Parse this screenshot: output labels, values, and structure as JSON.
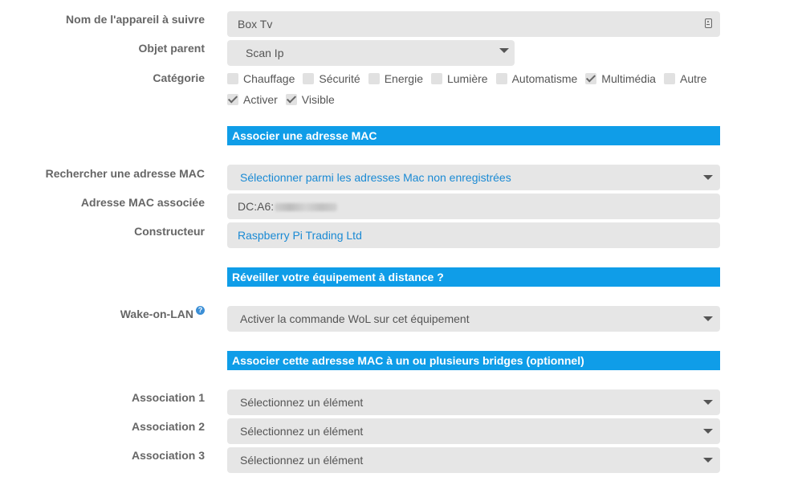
{
  "device_name": {
    "label": "Nom de l'appareil à suivre",
    "value": "Box Tv"
  },
  "parent": {
    "label": "Objet parent",
    "value": "Scan Ip"
  },
  "category": {
    "label": "Catégorie",
    "options": [
      {
        "label": "Chauffage",
        "checked": false
      },
      {
        "label": "Sécurité",
        "checked": false
      },
      {
        "label": "Energie",
        "checked": false
      },
      {
        "label": "Lumière",
        "checked": false
      },
      {
        "label": "Automatisme",
        "checked": false
      },
      {
        "label": "Multimédia",
        "checked": true
      },
      {
        "label": "Autre",
        "checked": false
      }
    ],
    "flags": [
      {
        "label": "Activer",
        "checked": true
      },
      {
        "label": "Visible",
        "checked": true
      }
    ]
  },
  "section_mac": {
    "title": "Associer une adresse MAC"
  },
  "search_mac": {
    "label": "Rechercher une adresse MAC",
    "value": "Sélectionner parmi les adresses Mac non enregistrées"
  },
  "mac": {
    "label": "Adresse MAC associée",
    "value": "DC:A6:"
  },
  "manufacturer": {
    "label": "Constructeur",
    "value": "Raspberry Pi Trading Ltd"
  },
  "section_wake": {
    "title": "Réveiller votre équipement à distance ?"
  },
  "wol": {
    "label": "Wake-on-LAN",
    "help_icon": "?",
    "value": "Activer la commande WoL sur cet équipement"
  },
  "section_bridges": {
    "title": "Associer cette adresse MAC à un ou plusieurs bridges (optionnel)"
  },
  "associations": [
    {
      "label": "Association 1",
      "value": "Sélectionnez un élément"
    },
    {
      "label": "Association 2",
      "value": "Sélectionnez un élément"
    },
    {
      "label": "Association 3",
      "value": "Sélectionnez un élément"
    }
  ],
  "colors": {
    "section_bg": "#0f9de8",
    "field_bg": "#e6e6e6",
    "link_text": "#1a8ad4"
  }
}
